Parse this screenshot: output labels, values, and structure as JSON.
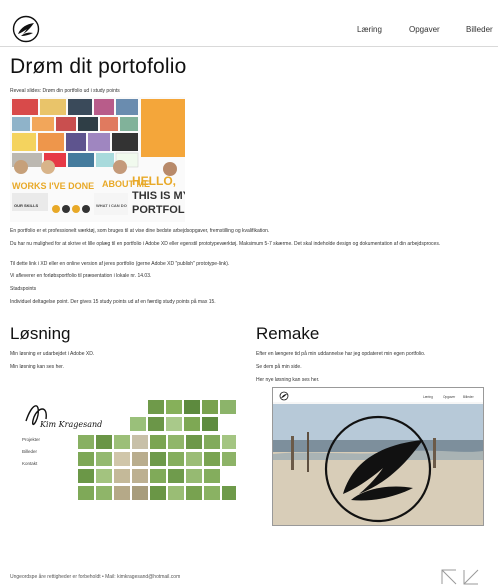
{
  "nav": {
    "items": [
      "Læring",
      "Opgaver",
      "Billeder"
    ]
  },
  "page": {
    "title": "Drøm dit portofolio",
    "intro": "Reveal slides: Drøm din portfolio ud i study points",
    "paragraphs": [
      "En portfolio er et professionelt værktøj, som bruges til at vise dine bedste arbejdsopgaver, fremstilling og kvalifikation.",
      "Du har nu mulighed for at skrive et lille oplæg til en portfolio i Adobe XD eller egenstil prototypeværktøj. Maksimum 5-7 skærme. Det skal indeholde design og dokumentation af din arbejdsproces.",
      "Til dette link i XD eller en online version af jeres portfolio (gerne Adobe XD \"publish\" prototype-link).",
      "Vi afleverer en forløbsportfolio til præsentation i lokale nr. 14.03.",
      "Stadspoints",
      "Individuel deltagelse point. Der gives 15 study points ud af en færdig study points på max 15."
    ]
  },
  "collage": {
    "tiles": [
      "WORKS I'VE DONE",
      "ABOUT ME",
      "HELLO,",
      "THIS IS MY",
      "PORTFOLIO",
      "WHAT I CAN DO",
      "OUR SKILLS"
    ],
    "orange": "#f4a63a",
    "gold": "#e8a928"
  },
  "loesning": {
    "title": "Løsning",
    "lines": [
      "Min løsning er udarbejdet i Adobe XD.",
      "Min løsning kan ses her."
    ],
    "brand": "Kim Kragesand",
    "menu": [
      "Projekter",
      "Billeder",
      "Kontakt"
    ]
  },
  "remake": {
    "title": "Remake",
    "lines": [
      "Efter en længere tid på min uddannelse har jeg opdateret min egen portfolio.",
      "Se dem på min side.",
      "Her nye løsning kan ses her."
    ],
    "nav": [
      "Læring",
      "Opgaver",
      "Billeder"
    ]
  },
  "footer": {
    "text": "Ungeordspe åre rettigheder er forbeholdt • Mail: kimkragesand@hotmail.com"
  },
  "colors": {
    "accent": "#f4a63a",
    "text": "#222222",
    "rule": "#d9d9d9"
  }
}
